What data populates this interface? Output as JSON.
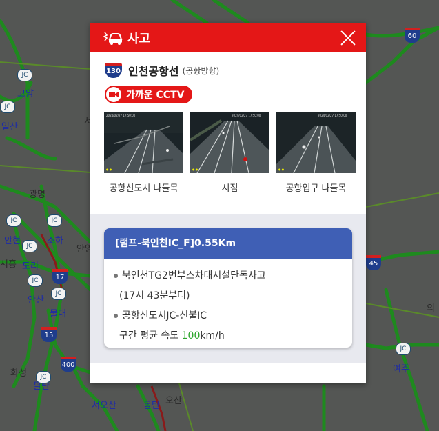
{
  "popup": {
    "title": "사고",
    "route_number": "130",
    "road_name": "인천공항선",
    "direction": "(공항방향)",
    "cctv_label": "가까운 CCTV",
    "cameras": [
      {
        "label": "공항신도시 나들목",
        "overlay": "2024/02/27 17:50:00"
      },
      {
        "label": "시점",
        "overlay": "2024/02/27 17:50:00"
      },
      {
        "label": "공항입구 나들목",
        "overlay": "2024/02/27 17:50:00"
      }
    ],
    "incident": {
      "header": "[램프-북인천IC_F]0.55Km",
      "line1": "북인천TG2번부스차대시설단독사고",
      "line2": "(17시 43분부터)",
      "line3": "공항신도시JC-신불IC",
      "speed_prefix": "구간 평균 속도 ",
      "speed_value": "100",
      "speed_unit": "km/h"
    }
  },
  "map": {
    "labels": [
      {
        "text": "고양"
      },
      {
        "text": "일산"
      },
      {
        "text": "광명"
      },
      {
        "text": "안현"
      },
      {
        "text": "조하"
      },
      {
        "text": "도리"
      },
      {
        "text": "시흥"
      },
      {
        "text": "안산"
      },
      {
        "text": "물대"
      },
      {
        "text": "화성"
      },
      {
        "text": "팔탄"
      },
      {
        "text": "서오산"
      },
      {
        "text": "동탄"
      },
      {
        "text": "오산"
      },
      {
        "text": "여주"
      },
      {
        "text": "의"
      },
      {
        "text": "안양"
      },
      {
        "text": "서"
      }
    ],
    "shields": [
      "60",
      "17",
      "45",
      "15",
      "400"
    ],
    "junction": "JC"
  },
  "colors": {
    "header_red": "#e41717",
    "card_blue": "#3f5fb5",
    "speed_green": "#2aa52a",
    "map_bg": "#545654",
    "road_green": "#1f7a1f"
  }
}
